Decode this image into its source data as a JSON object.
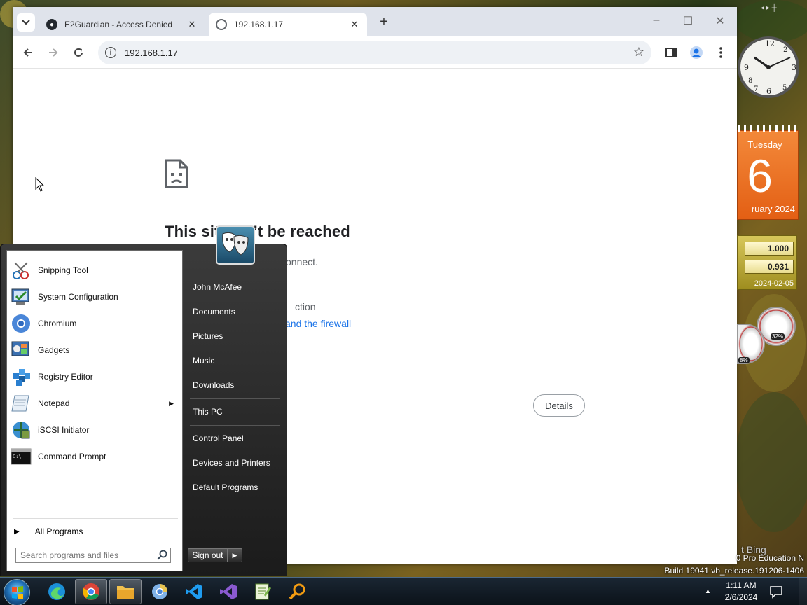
{
  "browser": {
    "tabs": [
      {
        "title": "E2Guardian - Access Denied",
        "active": false
      },
      {
        "title": "192.168.1.17",
        "active": true
      }
    ],
    "address": "192.168.1.17",
    "error": {
      "title_visible_left": "This sit",
      "title_visible_right": "’t be reached",
      "sub_visible": "onnect.",
      "try_line1_visible": "ction",
      "try_line2_link_visible": "and the firewall",
      "details_label": "Details"
    }
  },
  "gadgets": {
    "calendar": {
      "weekday": "Tuesday",
      "day": "6",
      "month_year": "ruary 2024"
    },
    "currency": {
      "value1": "1.000",
      "value2": "0.931",
      "date": "2024-02-05"
    },
    "cpu_meter": "32%",
    "ram_meter": "8%"
  },
  "watermark": {
    "bing": "t Bing",
    "edition": "0 Pro Education N",
    "build": "Build 19041.vb_release.191206-1406"
  },
  "start_menu": {
    "programs": [
      {
        "label": "Snipping Tool",
        "icon": "scissors-icon"
      },
      {
        "label": "System Configuration",
        "icon": "msconfig-icon"
      },
      {
        "label": "Chromium",
        "icon": "chromium-icon"
      },
      {
        "label": "Gadgets",
        "icon": "gadgets-icon"
      },
      {
        "label": "Registry Editor",
        "icon": "regedit-icon"
      },
      {
        "label": "Notepad",
        "icon": "notepad-icon",
        "submenu": true
      },
      {
        "label": "iSCSI Initiator",
        "icon": "iscsi-icon"
      },
      {
        "label": "Command Prompt",
        "icon": "cmd-icon"
      }
    ],
    "all_programs": "All Programs",
    "search_placeholder": "Search programs and files",
    "user_name": "John McAfee",
    "right_links": {
      "documents": "Documents",
      "pictures": "Pictures",
      "music": "Music",
      "downloads": "Downloads",
      "this_pc": "This PC",
      "control_panel": "Control Panel",
      "devices_printers": "Devices and Printers",
      "default_programs": "Default Programs"
    },
    "sign_out": "Sign out"
  },
  "taskbar": {
    "apps": [
      "edge-icon",
      "chrome-icon",
      "file-explorer-icon",
      "chromium-icon",
      "vscode-icon",
      "visual-studio-icon",
      "notepadplusplus-icon",
      "search-tool-icon"
    ],
    "time": "1:11 AM",
    "date": "2/6/2024"
  },
  "colors": {
    "link": "#1a73e8",
    "calendar": "#e8661a"
  }
}
